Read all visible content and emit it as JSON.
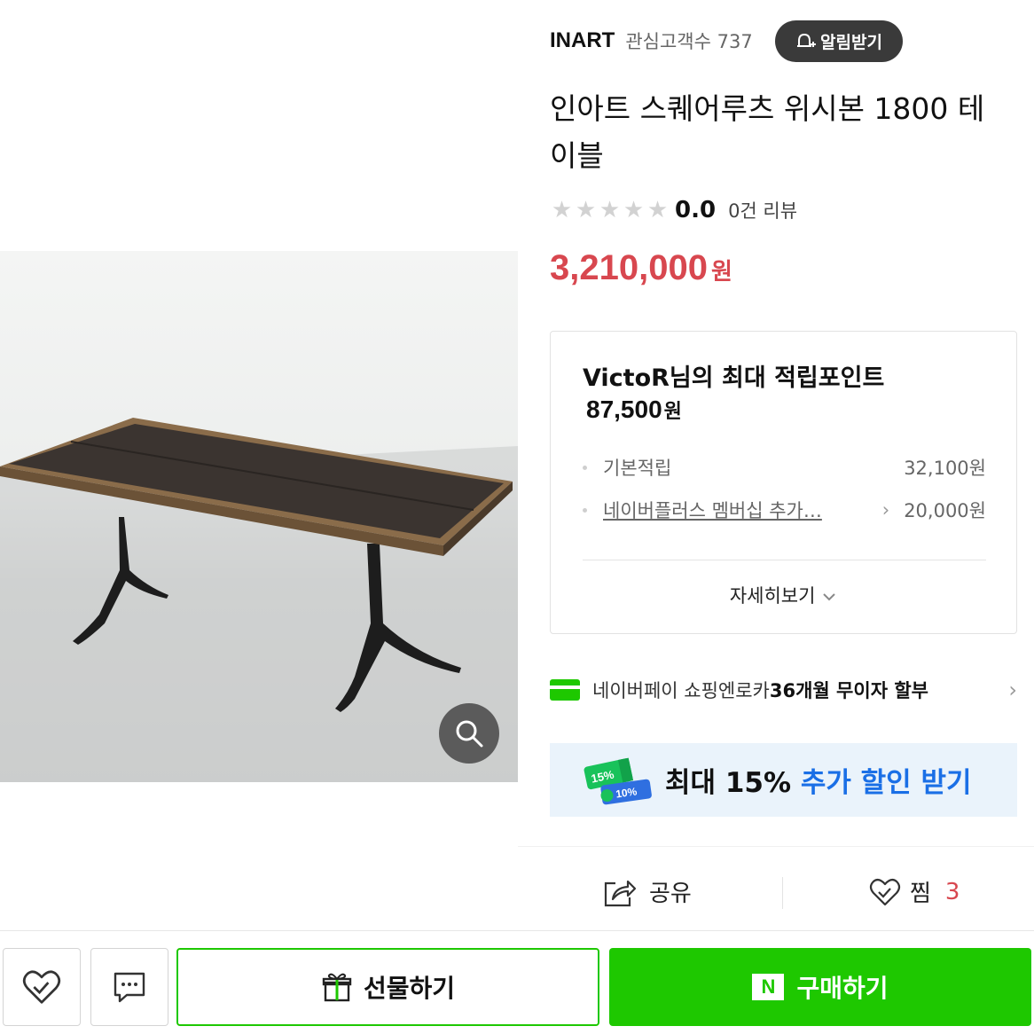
{
  "store": {
    "name": "INART",
    "fans_label": "관심고객수 737",
    "alarm_button": "알림받기"
  },
  "product": {
    "title": "인아트 스퀘어루츠 위시본 1800 테이블",
    "rating_score": "0.0",
    "rating_stars": 0,
    "review_count": "0건 리뷰",
    "price": "3,210,000",
    "price_unit": "원"
  },
  "points": {
    "title": "VictoR님의 최대 적립포인트",
    "total": "87,500",
    "total_unit": "원",
    "rows": [
      {
        "label": "기본적립",
        "value": "32,100원"
      },
      {
        "label": "네이버플러스 멤버십 추가…",
        "value": "20,000원"
      }
    ],
    "detail_link": "자세히보기"
  },
  "payment": {
    "prefix": "네이버페이 쇼핑엔로카 ",
    "highlight": "36개월 무이자 할부"
  },
  "coupon": {
    "badge_top": "15%",
    "badge_bottom": "10%",
    "text_prefix": "최대 15% ",
    "text_highlight": "추가 할인 받기"
  },
  "actions": {
    "share_label": "공유",
    "like_label": "찜",
    "like_count": "3"
  },
  "bottom_bar": {
    "gift_label": "선물하기",
    "buy_label": "구매하기",
    "buy_logo": "N"
  },
  "colors": {
    "accent_green": "#1ec800",
    "price_red": "#d8474f",
    "coupon_blue": "#1a6fe6"
  },
  "icons": [
    "zoom-icon",
    "bell-plus-icon",
    "star-icon",
    "chevron-right-icon",
    "chevron-down-icon",
    "card-icon",
    "coupon-ticket-icon",
    "share-icon",
    "heart-icon",
    "chat-icon",
    "gift-icon",
    "naver-n-icon"
  ]
}
